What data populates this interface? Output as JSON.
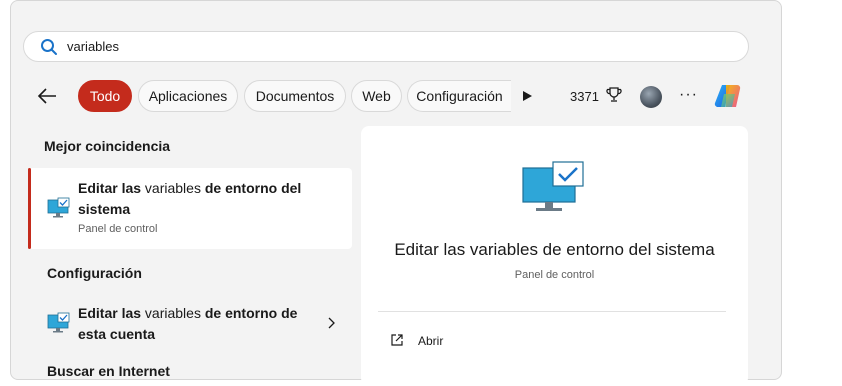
{
  "search": {
    "value": "variables"
  },
  "filters": {
    "items": [
      {
        "label": "Todo",
        "active": true
      },
      {
        "label": "Aplicaciones"
      },
      {
        "label": "Documentos"
      },
      {
        "label": "Web"
      },
      {
        "label": "Configuración"
      }
    ],
    "points": "3371"
  },
  "results": {
    "best_match_heading": "Mejor coincidencia",
    "best_match": {
      "title_line1_pre": "Editar las",
      "title_line1_mid": " variables ",
      "title_line1_post": "de entorno del",
      "title_line2": "sistema",
      "subtitle": "Panel de control"
    },
    "settings_heading": "Configuración",
    "settings_item": {
      "title_line1_pre": "Editar las",
      "title_line1_mid": " variables ",
      "title_line1_post": "de entorno de",
      "title_line2": "esta cuenta"
    },
    "web_heading": "Buscar en Internet"
  },
  "detail": {
    "title": "Editar las variables de entorno del sistema",
    "subtitle": "Panel de control",
    "actions": [
      {
        "label": "Abrir"
      }
    ]
  },
  "colors": {
    "accent": "#c42b1c",
    "monitor": "#2ea6d8"
  }
}
